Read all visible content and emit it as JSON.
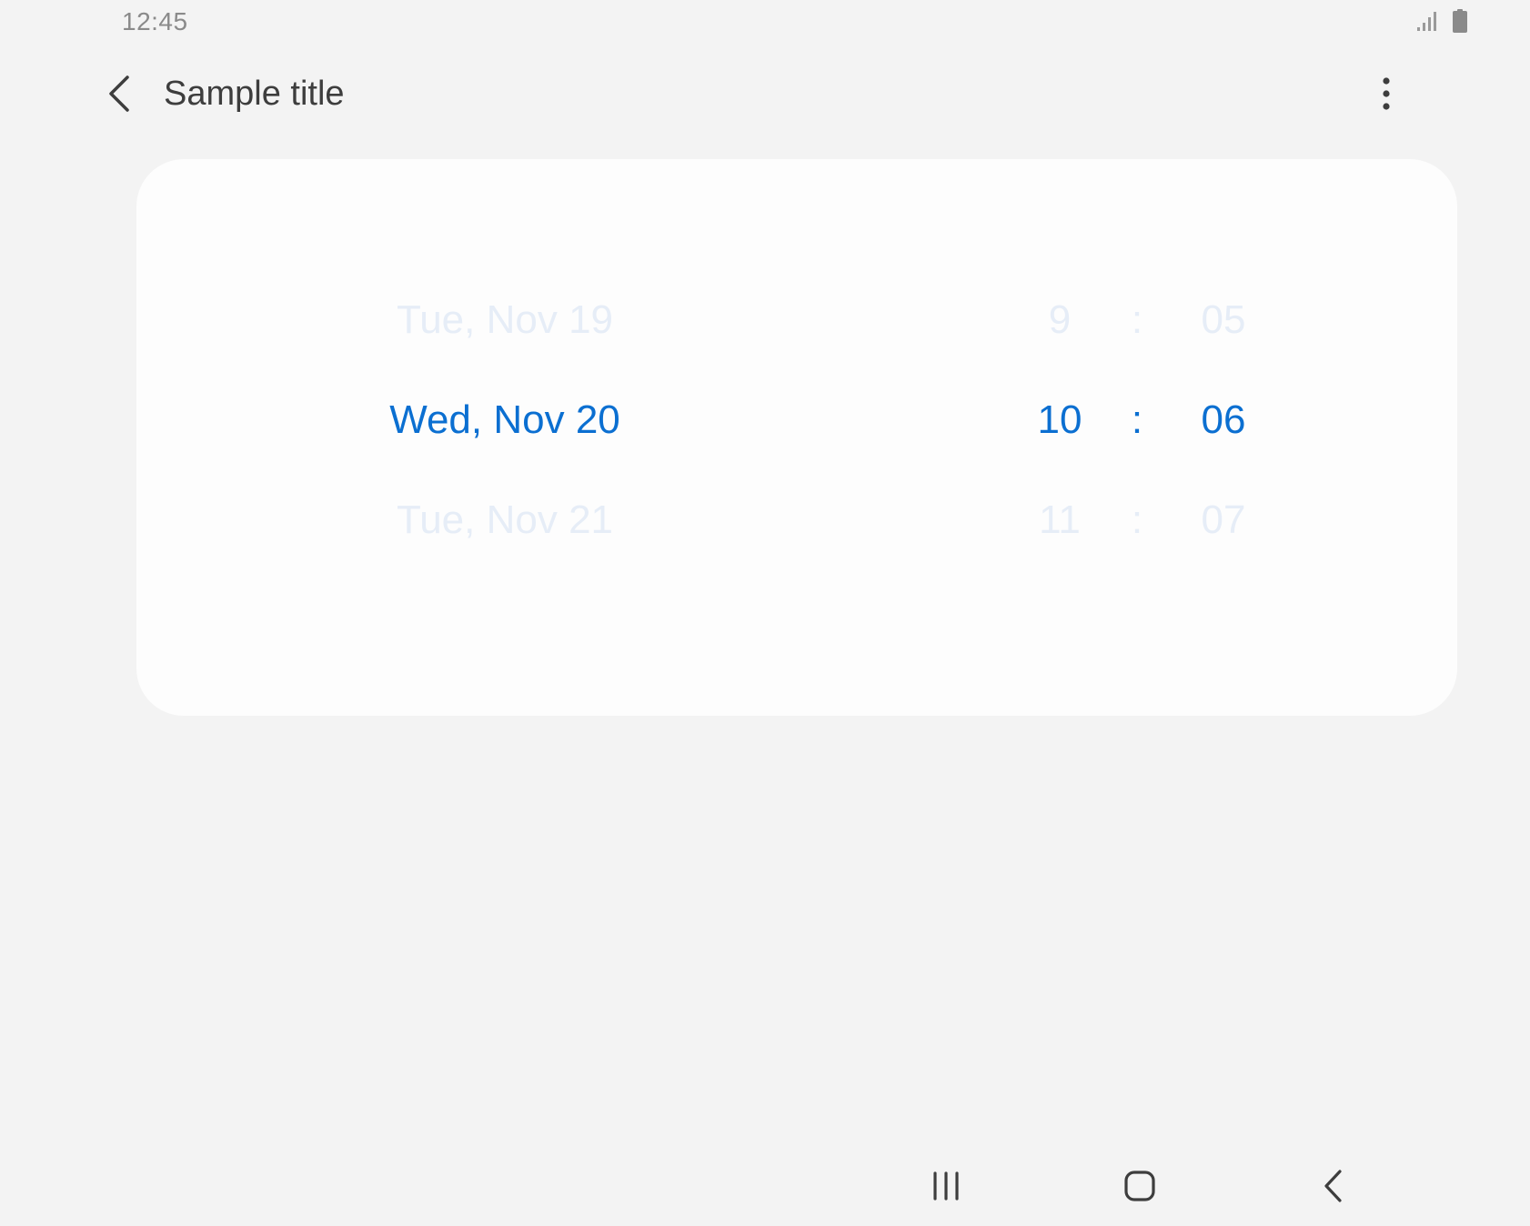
{
  "status_bar": {
    "time": "12:45",
    "icons": [
      "signal-icon",
      "battery-icon"
    ]
  },
  "app_bar": {
    "title": "Sample title",
    "back_icon": "chevron-left-icon",
    "more_icon": "more-vertical-icon"
  },
  "picker": {
    "date": {
      "previous": "Tue, Nov 19",
      "selected": "Wed, Nov 20",
      "next": "Tue, Nov 21"
    },
    "hour": {
      "previous": "9",
      "selected": "10",
      "next": "11"
    },
    "separator": ":",
    "minute": {
      "previous": "05",
      "selected": "06",
      "next": "07"
    },
    "colors": {
      "selected": "#0b6fd1",
      "faded": "#e6edf7"
    }
  },
  "nav_bar": {
    "icons": [
      "recents-icon",
      "home-icon",
      "back-icon"
    ]
  }
}
